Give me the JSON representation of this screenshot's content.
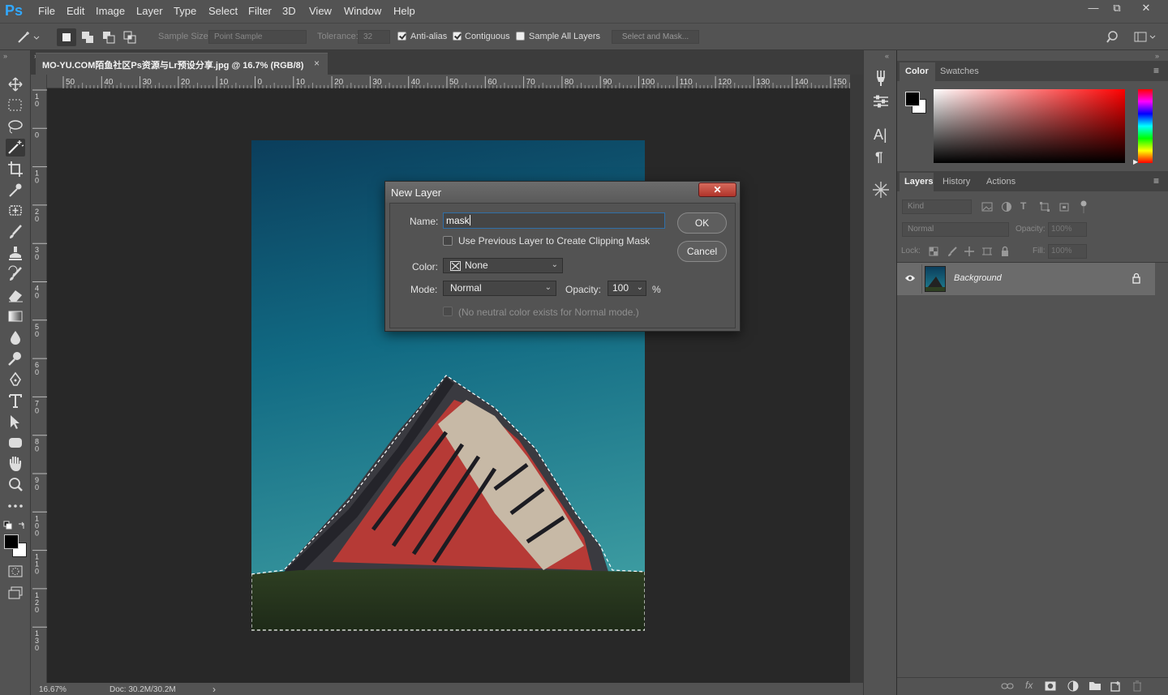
{
  "app": {
    "logo": "Ps"
  },
  "menubar": {
    "items": [
      "File",
      "Edit",
      "Image",
      "Layer",
      "Type",
      "Select",
      "Filter",
      "3D",
      "View",
      "Window",
      "Help"
    ]
  },
  "window_controls": {
    "minimize": "—",
    "restore": "⧉",
    "close": "✕"
  },
  "options_bar": {
    "sample_size_label": "Sample Size:",
    "sample_size_value": "Point Sample",
    "tolerance_label": "Tolerance:",
    "tolerance_value": "32",
    "anti_alias_label": "Anti-alias",
    "anti_alias_checked": true,
    "contiguous_label": "Contiguous",
    "contiguous_checked": true,
    "sample_all_layers_label": "Sample All Layers",
    "sample_all_layers_checked": false,
    "select_mask_label": "Select and Mask..."
  },
  "document": {
    "tab_title": "MO-YU.COM陌鱼社区Ps资源与Lr预设分享.jpg @ 16.7% (RGB/8)",
    "tab_close": "×",
    "zoom": "16.67%",
    "doc_size": "Doc: 30.2M/30.2M"
  },
  "rulers": {
    "horizontal": [
      "50",
      "40",
      "30",
      "20",
      "10",
      "0",
      "10",
      "20",
      "30",
      "40",
      "50",
      "60",
      "70",
      "80",
      "90",
      "100",
      "110",
      "120",
      "130",
      "140",
      "150"
    ],
    "vertical": [
      "1\n0",
      "0",
      "1\n0",
      "2\n0",
      "3\n0",
      "4\n0",
      "5\n0",
      "6\n0",
      "7\n0",
      "8\n0",
      "9\n0",
      "1\n0\n0",
      "1\n1\n0",
      "1\n2\n0",
      "1\n3\n0"
    ]
  },
  "color_panel": {
    "tabs": [
      "Color",
      "Swatches"
    ],
    "active": "Color",
    "hue_color": "#ff0000"
  },
  "layers_panel": {
    "tabs": [
      "Layers",
      "History",
      "Actions"
    ],
    "active": "Layers",
    "kind_placeholder": "Kind",
    "blend_mode": "Normal",
    "opacity_label": "Opacity:",
    "opacity_value": "100%",
    "lock_label": "Lock:",
    "fill_label": "Fill:",
    "fill_value": "100%",
    "layers": [
      {
        "name": "Background",
        "visible": true,
        "locked": true
      }
    ]
  },
  "dialog": {
    "title": "New Layer",
    "close": "✕",
    "name_label": "Name:",
    "name_value": "mask",
    "clipping_label": "Use Previous Layer to Create Clipping Mask",
    "clipping_checked": false,
    "color_label": "Color:",
    "color_value": "None",
    "mode_label": "Mode:",
    "mode_value": "Normal",
    "opacity_label": "Opacity:",
    "opacity_value": "100",
    "opacity_unit": "%",
    "neutral_label": "(No neutral color exists for Normal mode.)",
    "ok_label": "OK",
    "cancel_label": "Cancel"
  },
  "colors": {
    "ui_bg": "#535353",
    "canvas_bg": "#282828",
    "accent": "#31a8ff"
  }
}
